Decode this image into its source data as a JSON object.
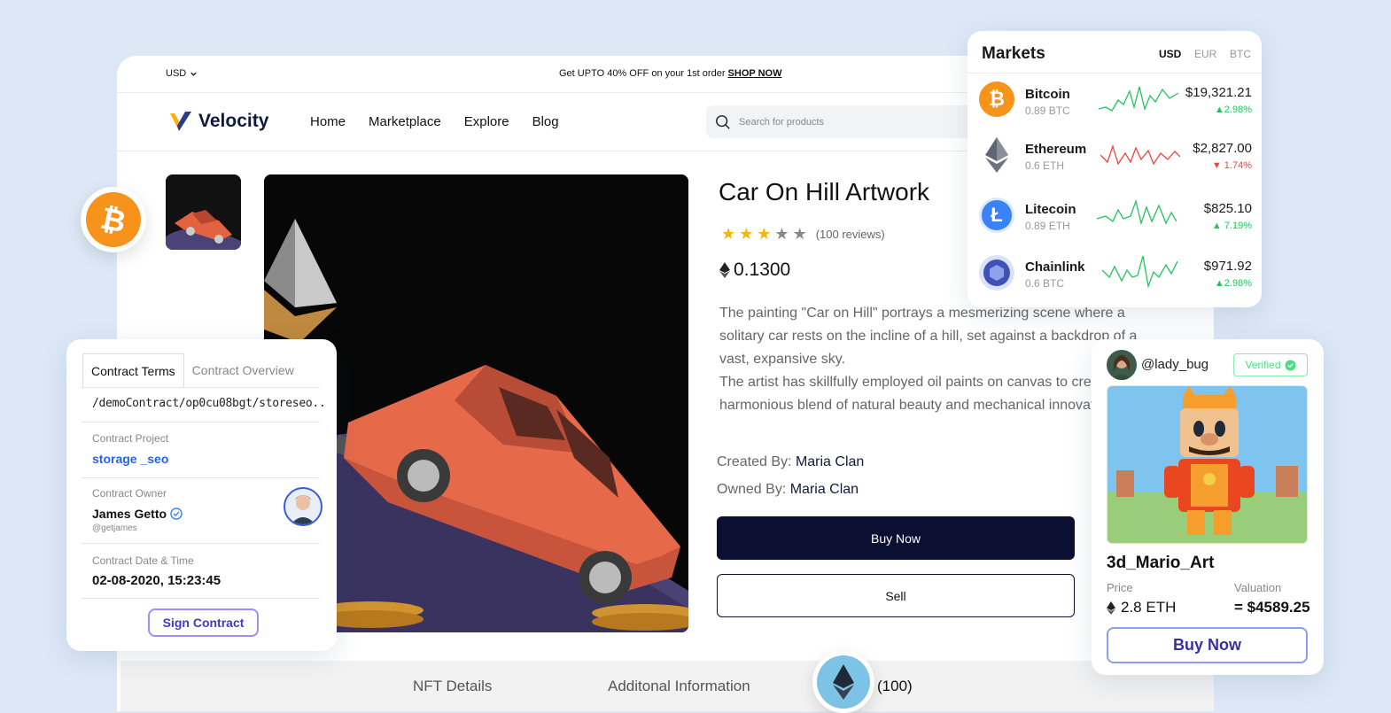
{
  "shop": {
    "currency": "USD",
    "promo_text": "Get UPTO 40% OFF on your 1st order",
    "promo_link": "SHOP NOW",
    "brand": "Velocity",
    "menu": [
      "Home",
      "Marketplace",
      "Explore",
      "Blog"
    ],
    "search_placeholder": "Search for products"
  },
  "product": {
    "title": "Car On Hill Artwork",
    "rating": 3,
    "rating_max": 5,
    "reviews": "(100 reviews)",
    "price": "0.1300",
    "description_1": "The painting \"Car on Hill\" portrays a mesmerizing scene where a solitary car rests on the incline of a hill, set against a backdrop of a vast, expansive sky.",
    "description_2": "The artist has skillfully employed oil paints on canvas to create a harmonious blend of natural beauty and mechanical innovation.",
    "created_label": "Created By:",
    "created_by": "Maria Clan",
    "owned_label": "Owned By:",
    "owned_by": "Maria Clan",
    "buy_label": "Buy Now",
    "sell_label": "Sell"
  },
  "bottom_tabs": {
    "nft_details": "NFT Details",
    "additional": "Additonal Information",
    "reviews": "(100)"
  },
  "markets": {
    "title": "Markets",
    "currencies": [
      "USD",
      "EUR",
      "BTC"
    ],
    "selected_currency": "USD",
    "coins": [
      {
        "name": "Bitcoin",
        "sub": "0.89 BTC",
        "value": "$19,321.21",
        "change": "2.98%",
        "direction": "up",
        "color": "#f7931a",
        "icon": "bitcoin-icon"
      },
      {
        "name": "Ethereum",
        "sub": "0.6  ETH",
        "value": "$2,827.00",
        "change": "1.74%",
        "direction": "down",
        "color": "#627eea",
        "icon": "ethereum-icon"
      },
      {
        "name": "Litecoin",
        "sub": "0.89 ETH",
        "value": "$825.10",
        "change": "7.19%",
        "direction": "up",
        "color": "#3b82f6",
        "icon": "litecoin-icon"
      },
      {
        "name": "Chainlink",
        "sub": "0.6 BTC",
        "value": "$971.92",
        "change": "2.98%",
        "direction": "up",
        "color": "#3f51b5",
        "icon": "chainlink-icon"
      }
    ],
    "up_color": "#22c55e",
    "down_color": "#ef4444"
  },
  "contract": {
    "tab_active": "Contract Terms",
    "tab_other": "Contract Overview",
    "path": "/demoContract/op0cu08bgt/storeseo..",
    "project_label": "Contract Project",
    "project_value": "storage _seo",
    "owner_label": "Contract Owner",
    "owner_name": "James Getto",
    "owner_handle": "@getjames",
    "date_label": "Contract Date & Time",
    "date_value": "02-08-2020, 15:23:45",
    "sign_label": "Sign Contract"
  },
  "nft_card": {
    "handle": "@lady_bug",
    "verified": "Verified",
    "title": "3d_Mario_Art",
    "price_label": "Price",
    "price_value": "2.8 ETH",
    "valuation_label": "Valuation",
    "valuation_value": "= $4589.25",
    "buy_label": "Buy Now"
  }
}
